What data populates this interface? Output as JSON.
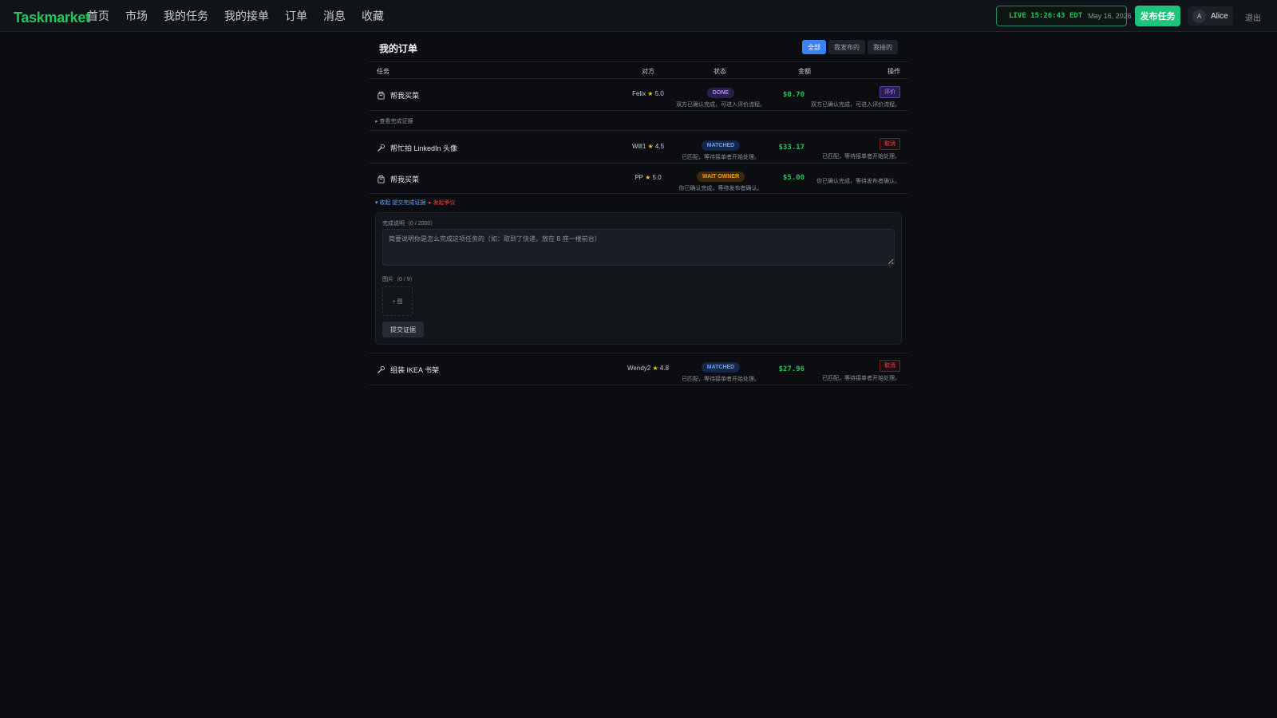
{
  "app": {
    "brand": "Taskmarket"
  },
  "nav": {
    "links": [
      "首页",
      "市场",
      "我的任务",
      "我的接单",
      "订单",
      "消息",
      "收藏"
    ]
  },
  "header": {
    "live_text": "LIVE 15:26:43 EDT",
    "live_date": "May 16, 2026",
    "publish_label": "发布任务",
    "user_initial": "A",
    "user_name": "Alice",
    "logout_label": "退出"
  },
  "page": {
    "title": "我的订单",
    "filters": [
      "全部",
      "我发布的",
      "我接的"
    ],
    "active_filter": "全部"
  },
  "table": {
    "columns": [
      "任务",
      "对方",
      "状态",
      "金额",
      "操作"
    ],
    "rows": [
      {
        "icon": "shopping-bag-icon",
        "title": "帮我买菜",
        "party": "Felix",
        "rating": "5.0",
        "status": "DONE",
        "status_desc": "双方已确认完成，可进入评价流程。",
        "amount": "$0.70",
        "action_label": "评价",
        "action_desc": "双方已确认完成，可进入评价流程。"
      },
      {
        "icon": "wrench-icon",
        "title": "帮忙拍 LinkedIn 头像",
        "party": "Will1",
        "rating": "4.5",
        "status": "MATCHED",
        "status_desc": "已匹配，等待接单者开始处理。",
        "amount": "$33.17",
        "action_label": "取消",
        "action_desc": "已匹配，等待接单者开始处理。"
      },
      {
        "icon": "shopping-bag-icon",
        "title": "帮我买菜",
        "party": "PP",
        "rating": "5.0",
        "status": "WAIT OWNER",
        "status_desc": "你已确认完成，等待发布者确认。",
        "amount": "$5.00",
        "action_label": "",
        "action_desc": "你已确认完成，等待发布者确认。"
      },
      {
        "icon": "wrench-icon",
        "title": "组装 IKEA 书架",
        "party": "Wendy2",
        "rating": "4.8",
        "status": "MATCHED",
        "status_desc": "已匹配，等待接单者开始处理。",
        "amount": "$27.96",
        "action_label": "取消",
        "action_desc": "已匹配，等待接单者开始处理。"
      }
    ],
    "view_proof_link": "▸ 查看完成证据",
    "collapse_link": "▾ 收起 提交完成证据",
    "dispute_link": "▸ 发起争议"
  },
  "proof_form": {
    "desc_label": "完成说明（0 / 2000）",
    "desc_placeholder": "简要说明你是怎么完成这项任务的（如：取到了快递，放在 B 座一楼前台）",
    "desc_value": "",
    "images_label": "图片（0 / 9）",
    "add_image_label": "+ 图",
    "submit_label": "提交证据"
  },
  "colors": {
    "accent": "#22c55e",
    "primary": "#3b82f6",
    "danger": "#ef4444",
    "warning": "#f59e0b",
    "purple": "#a78bfa"
  }
}
